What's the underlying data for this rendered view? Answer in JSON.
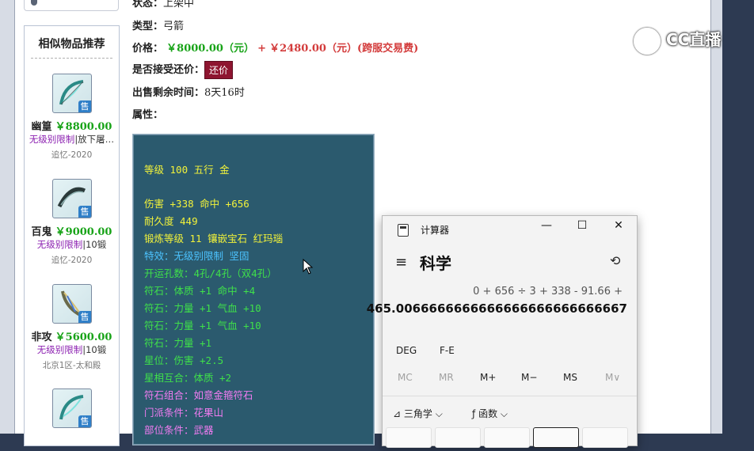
{
  "sidebar": {
    "title": "相似物品推荐",
    "sale_badge": "售",
    "items": [
      {
        "name": "幽篁",
        "price": "￥8800.00",
        "tag": "无级别限制",
        "tag2": "|放下屠…",
        "server": "追忆-2020"
      },
      {
        "name": "百鬼",
        "price": "￥9000.00",
        "tag": "无级别限制",
        "tag2": "|10锻",
        "server": "追忆-2020"
      },
      {
        "name": "非攻",
        "price": "￥5600.00",
        "tag": "无级别限制",
        "tag2": "|10锻",
        "server": "北京1区-太和殿"
      }
    ]
  },
  "info": {
    "status_label": "状态：",
    "status_value": "上架中",
    "type_label": "类型：",
    "type_value": "弓箭",
    "price_label": "价格：",
    "price_value": "￥8000.00（元）",
    "plus": "+",
    "fee_value": "￥2480.00（元）(跨服交易费)",
    "bargain_label": "是否接受还价：",
    "bargain_button": "还价",
    "time_label": "出售剩余时间：",
    "time_value": "8天16时",
    "attr_label": "属性："
  },
  "attributes": [
    {
      "text": "等级 100 五行 金",
      "cls": "y"
    },
    {
      "text": "伤害 +338 命中 +656",
      "cls": "y"
    },
    {
      "text": "耐久度 449",
      "cls": "y"
    },
    {
      "text": "锻炼等级 11 镶嵌宝石 红玛瑙",
      "cls": "y"
    },
    {
      "text": "特效：无级别限制 坚固",
      "cls": "c"
    },
    {
      "text": "开运孔数：4孔/4孔（双4孔）",
      "cls": "g"
    },
    {
      "text": "符石：体质 +1 命中 +4",
      "cls": "g"
    },
    {
      "text": "符石：力量 +1 气血 +10",
      "cls": "g"
    },
    {
      "text": "符石：力量 +1 气血 +10",
      "cls": "g"
    },
    {
      "text": "符石：力量 +1",
      "cls": "g"
    },
    {
      "text": "星位：伤害 +2.5",
      "cls": "g"
    },
    {
      "text": "星相互合：体质 +2",
      "cls": "g"
    },
    {
      "text": "符石组合：如意金箍符石",
      "cls": "pk"
    },
    {
      "text": "门派条件：花果山",
      "cls": "pk"
    },
    {
      "text": "部位条件：武器",
      "cls": "pk"
    }
  ],
  "watermark": {
    "text": "CC直播"
  },
  "calculator": {
    "title": "计算器",
    "minimize": "—",
    "maximize": "☐",
    "close": "✕",
    "menu_icon": "≡",
    "mode": "科学",
    "history_icon": "⟲",
    "expression": "0 + 656 ÷ 3 + 338 - 91.66 +",
    "result": "465.0066666666666666666666666667",
    "angle": "DEG",
    "fe": "F-E",
    "mem": [
      "MC",
      "MR",
      "M+",
      "M−",
      "MS",
      "M∨"
    ],
    "trig": "三角学",
    "func": "函数",
    "trig_icon": "⊿",
    "func_icon": "ƒ",
    "chevron": "⌵"
  },
  "colors": {
    "price_green": "#17a317",
    "fee_red": "#d33b3b",
    "attr_box": "#2b5a6e",
    "bargain_button": "#8e1530"
  }
}
